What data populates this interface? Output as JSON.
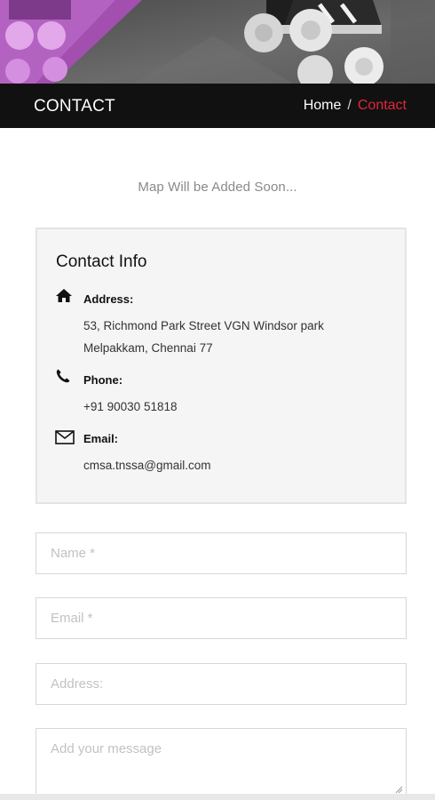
{
  "header": {
    "title": "CONTACT",
    "breadcrumb": {
      "home": "Home",
      "separator": "/",
      "current": "Contact"
    },
    "accent_color": "#e0263a"
  },
  "map_note": "Map Will be Added Soon...",
  "contact_info": {
    "title": "Contact Info",
    "address": {
      "label": "Address:",
      "line1": "53, Richmond Park Street VGN Windsor park",
      "line2": "Melpakkam, Chennai 77",
      "icon": "home-icon"
    },
    "phone": {
      "label": "Phone:",
      "value": "+91 90030 51818",
      "icon": "phone-icon"
    },
    "email": {
      "label": "Email:",
      "value": "cmsa.tnssa@gmail.com",
      "icon": "envelope-icon"
    }
  },
  "form": {
    "name_placeholder": "Name *",
    "email_placeholder": "Email *",
    "address_placeholder": "Address:",
    "message_placeholder": "Add your message"
  }
}
